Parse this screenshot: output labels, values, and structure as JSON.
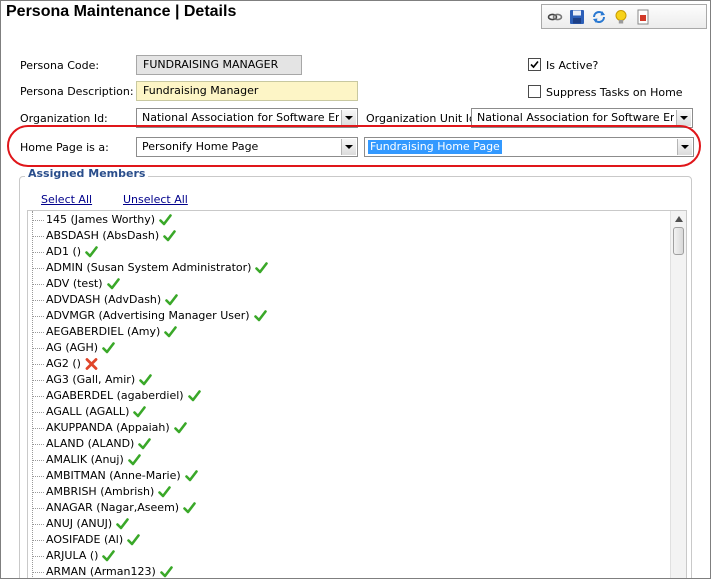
{
  "header": {
    "title": "Persona Maintenance  |  Details"
  },
  "toolbar": {
    "icons": [
      "link-icon",
      "save-icon",
      "refresh-icon",
      "lightbulb-icon",
      "report-icon"
    ]
  },
  "form": {
    "persona_code_label": "Persona Code:",
    "persona_code_value": "FUNDRAISING MANAGER",
    "persona_description_label": "Persona Description:",
    "persona_description_value": "Fundraising Manager",
    "org_id_label": "Organization Id:",
    "org_id_value": "National Association for Software Engine",
    "org_unit_label": "Organization Unit Id:",
    "org_unit_value": "National Association for Software Engine",
    "is_active_label": "Is Active?",
    "is_active_checked": true,
    "suppress_label": "Suppress Tasks on Home",
    "suppress_checked": false,
    "home_page_label": "Home Page is a:",
    "home_page_type_value": "Personify Home Page",
    "home_page_value": "Fundraising Home Page"
  },
  "members": {
    "group_title": "Assigned Members",
    "select_all": "Select All",
    "unselect_all": "Unselect All",
    "items": [
      {
        "label": "145 (James Worthy)",
        "status": "check"
      },
      {
        "label": "ABSDASH (AbsDash)",
        "status": "check"
      },
      {
        "label": "AD1 ()",
        "status": "check"
      },
      {
        "label": "ADMIN (Susan System Administrator)",
        "status": "check"
      },
      {
        "label": "ADV (test)",
        "status": "check"
      },
      {
        "label": "ADVDASH (AdvDash)",
        "status": "check"
      },
      {
        "label": "ADVMGR (Advertising Manager User)",
        "status": "check"
      },
      {
        "label": "AEGABERDIEL (Amy)",
        "status": "check"
      },
      {
        "label": "AG (AGH)",
        "status": "check"
      },
      {
        "label": "AG2 ()",
        "status": "cross"
      },
      {
        "label": "AG3 (Gall, Amir)",
        "status": "check"
      },
      {
        "label": "AGABERDEL (agaberdiel)",
        "status": "check"
      },
      {
        "label": "AGALL (AGALL)",
        "status": "check"
      },
      {
        "label": "AKUPPANDA (Appaiah)",
        "status": "check"
      },
      {
        "label": "ALAND (ALAND)",
        "status": "check"
      },
      {
        "label": "AMALIK (Anuj)",
        "status": "check"
      },
      {
        "label": "AMBITMAN (Anne-Marie)",
        "status": "check"
      },
      {
        "label": "AMBRISH (Ambrish)",
        "status": "check"
      },
      {
        "label": "ANAGAR (Nagar,Aseem)",
        "status": "check"
      },
      {
        "label": "ANUJ (ANUJ)",
        "status": "check"
      },
      {
        "label": "AOSIFADE (Al)",
        "status": "check"
      },
      {
        "label": "ARJULA ()",
        "status": "check"
      },
      {
        "label": "ARMAN (Arman123)",
        "status": "check"
      }
    ]
  },
  "colors": {
    "highlight_oval": "#e0161a",
    "selection": "#3399ff",
    "group_title": "#2a4e8c",
    "check": "#3aa829",
    "cross": "#e0452a"
  }
}
